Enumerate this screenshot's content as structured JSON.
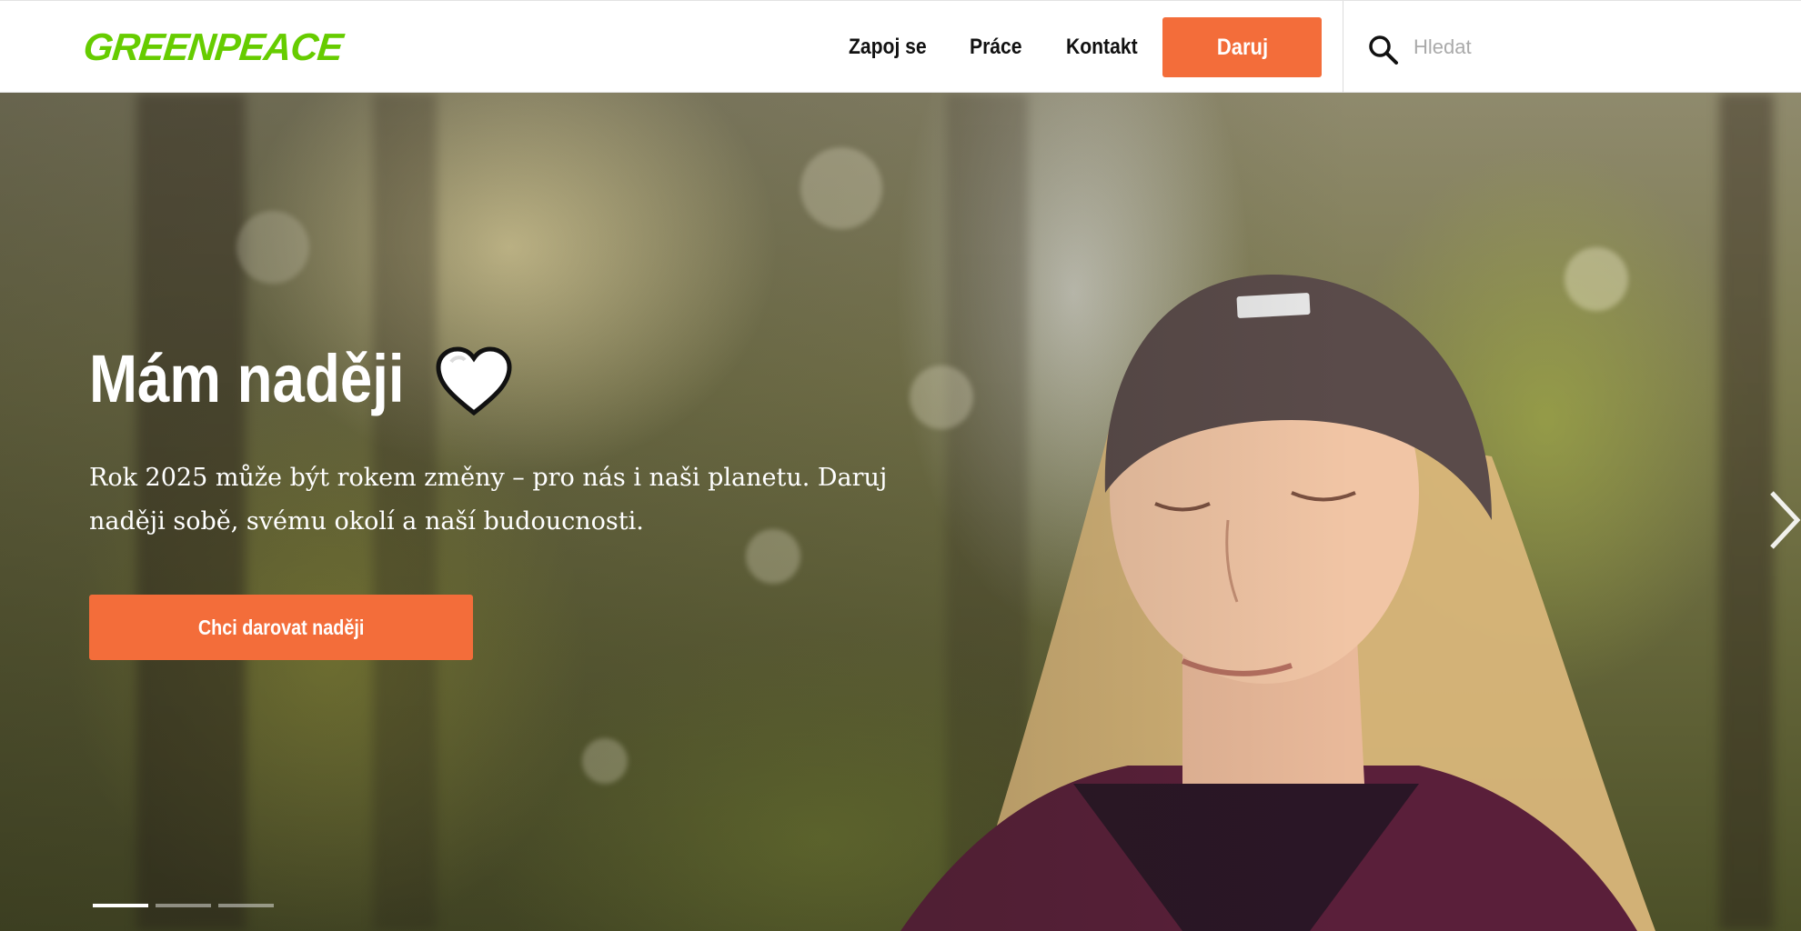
{
  "header": {
    "logo_text": "GREENPEACE",
    "nav": [
      {
        "label": "Zapoj se"
      },
      {
        "label": "Práce"
      },
      {
        "label": "Kontakt"
      }
    ],
    "donate_label": "Daruj",
    "search": {
      "placeholder": "Hledat",
      "value": ""
    }
  },
  "hero": {
    "title": "Mám naději",
    "subtitle": "Rok 2025 může být rokem změny – pro nás i naši planetu. Daruj naději sobě, svému okolí a naší budoucnosti.",
    "cta_label": "Chci darovat naději",
    "slides_total": 3,
    "active_slide": 1
  },
  "colors": {
    "brand_green": "#66cc00",
    "accent_orange": "#f36d3a"
  },
  "icons": [
    "search-icon",
    "heart-icon",
    "chevron-right-icon"
  ]
}
